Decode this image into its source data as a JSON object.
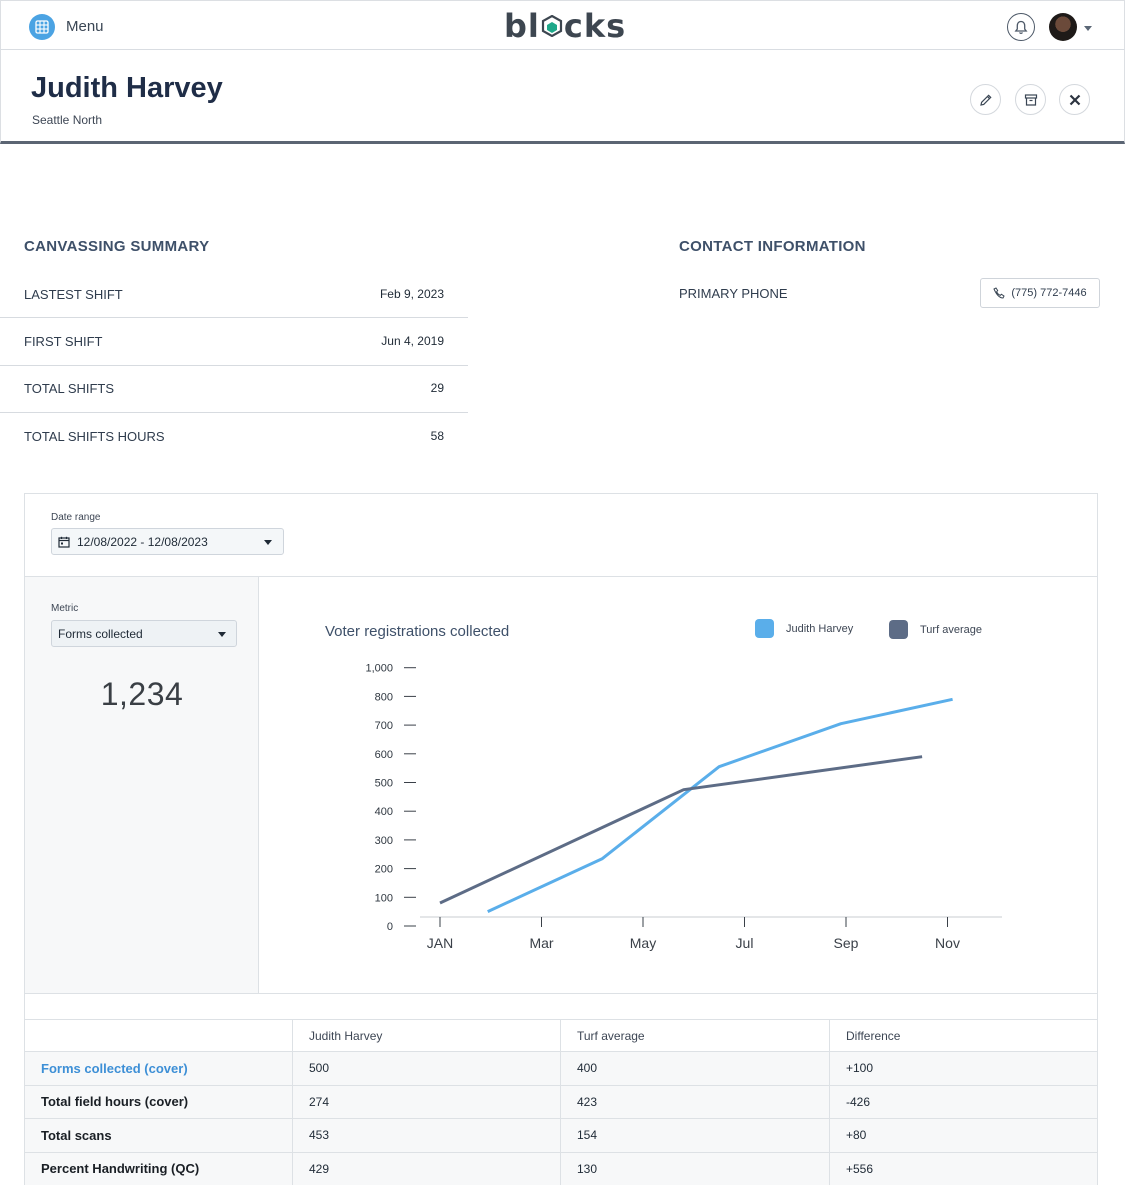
{
  "nav": {
    "menu_label": "Menu",
    "logo_prefix": "bl",
    "logo_suffix": "cks",
    "menu_icon": "grid-icon",
    "notifications_icon": "bell-icon"
  },
  "person": {
    "name": "Judith Harvey",
    "location": "Seattle North"
  },
  "header_actions": [
    "pencil-icon",
    "archive-icon",
    "close-icon"
  ],
  "summary": {
    "title": "CANVASSING SUMMARY",
    "rows": [
      {
        "label": "LASTEST SHIFT",
        "value": "Feb 9, 2023"
      },
      {
        "label": "FIRST SHIFT",
        "value": "Jun 4, 2019"
      },
      {
        "label": "TOTAL SHIFTS",
        "value": "29"
      },
      {
        "label": "TOTAL SHIFTS HOURS",
        "value": "58"
      }
    ]
  },
  "contact": {
    "title": "CONTACT INFORMATION",
    "phone_label": "PRIMARY PHONE",
    "phone": "(775) 772-7446"
  },
  "filters": {
    "date_range_label": "Date range",
    "date_range_value": "12/08/2022 - 12/08/2023",
    "metric_label": "Metric",
    "metric_value": "Forms collected"
  },
  "metric_total": "1,234",
  "chart_data": {
    "type": "line",
    "title": "Voter registrations collected",
    "x": [
      "JAN",
      "Mar",
      "May",
      "Jul",
      "Sep",
      "Nov"
    ],
    "ylim": [
      0,
      1000
    ],
    "yticks": [
      "0",
      "100",
      "200",
      "300",
      "400",
      "500",
      "600",
      "700",
      "800",
      "1,000"
    ],
    "legend_position": "top-right",
    "series": [
      {
        "name": "Judith Harvey",
        "color": "#5aaeea",
        "points": [
          [
            1.47,
            50
          ],
          [
            2.6,
            235
          ],
          [
            3.75,
            555
          ],
          [
            4.95,
            705
          ],
          [
            6.05,
            790
          ]
        ]
      },
      {
        "name": "Turf average",
        "color": "#5d6c86",
        "points": [
          [
            1.0,
            80
          ],
          [
            3.4,
            475
          ],
          [
            5.75,
            590
          ]
        ]
      }
    ]
  },
  "table": {
    "headers": [
      "",
      "Judith Harvey",
      "Turf average",
      "Difference"
    ],
    "rows": [
      {
        "label": "Forms collected (cover)",
        "values": [
          "500",
          "400",
          "+100"
        ],
        "link": true
      },
      {
        "label": "Total field hours (cover)",
        "values": [
          "274",
          "423",
          "-426"
        ],
        "link": false
      },
      {
        "label": "Total scans",
        "values": [
          "453",
          "154",
          "+80"
        ],
        "link": false
      },
      {
        "label": "Percent Handwriting (QC)",
        "values": [
          "429",
          "130",
          "+556"
        ],
        "link": false
      }
    ]
  },
  "colors": {
    "accent": "#4ba3e3",
    "header_border": "#5b6573",
    "section_title": "#3e5069"
  }
}
